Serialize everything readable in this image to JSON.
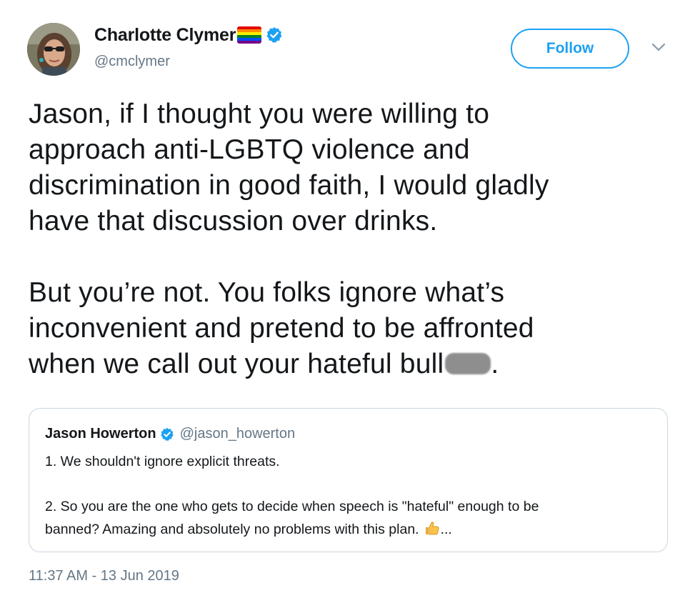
{
  "author": {
    "display_name": "Charlotte Clymer",
    "handle": "@cmclymer",
    "flag_emoji": "rainbow-flag-icon",
    "verified": true
  },
  "actions": {
    "follow_label": "Follow",
    "menu_icon": "chevron-down-icon"
  },
  "tweet": {
    "para1_lines": [
      "Jason, if I thought you were willing to",
      "approach anti-LGBTQ violence and",
      "discrimination in good faith, I would gladly",
      "have that discussion over drinks."
    ],
    "para2_lines": [
      "But you’re not. You folks ignore what’s",
      "inconvenient and pretend to be affronted"
    ],
    "para2_last_prefix": "when we call out your hateful bull",
    "para2_last_suffix": "."
  },
  "quoted_tweet": {
    "display_name": "Jason Howerton",
    "handle": "@jason_howerton",
    "verified": true,
    "line1": "1. We shouldn't ignore explicit threats.",
    "line2": "2. So you are the one who gets to decide when speech is \"hateful\" enough to be",
    "line3": "banned? Amazing and absolutely no problems with this plan.",
    "line3_suffix": "...",
    "emoji": "thumbs-up-icon"
  },
  "timestamp": "11:37 AM - 13 Jun 2019",
  "colors": {
    "accent": "#1da1f2",
    "text": "#14171a",
    "muted": "#657786",
    "border": "#ccd6dd"
  }
}
